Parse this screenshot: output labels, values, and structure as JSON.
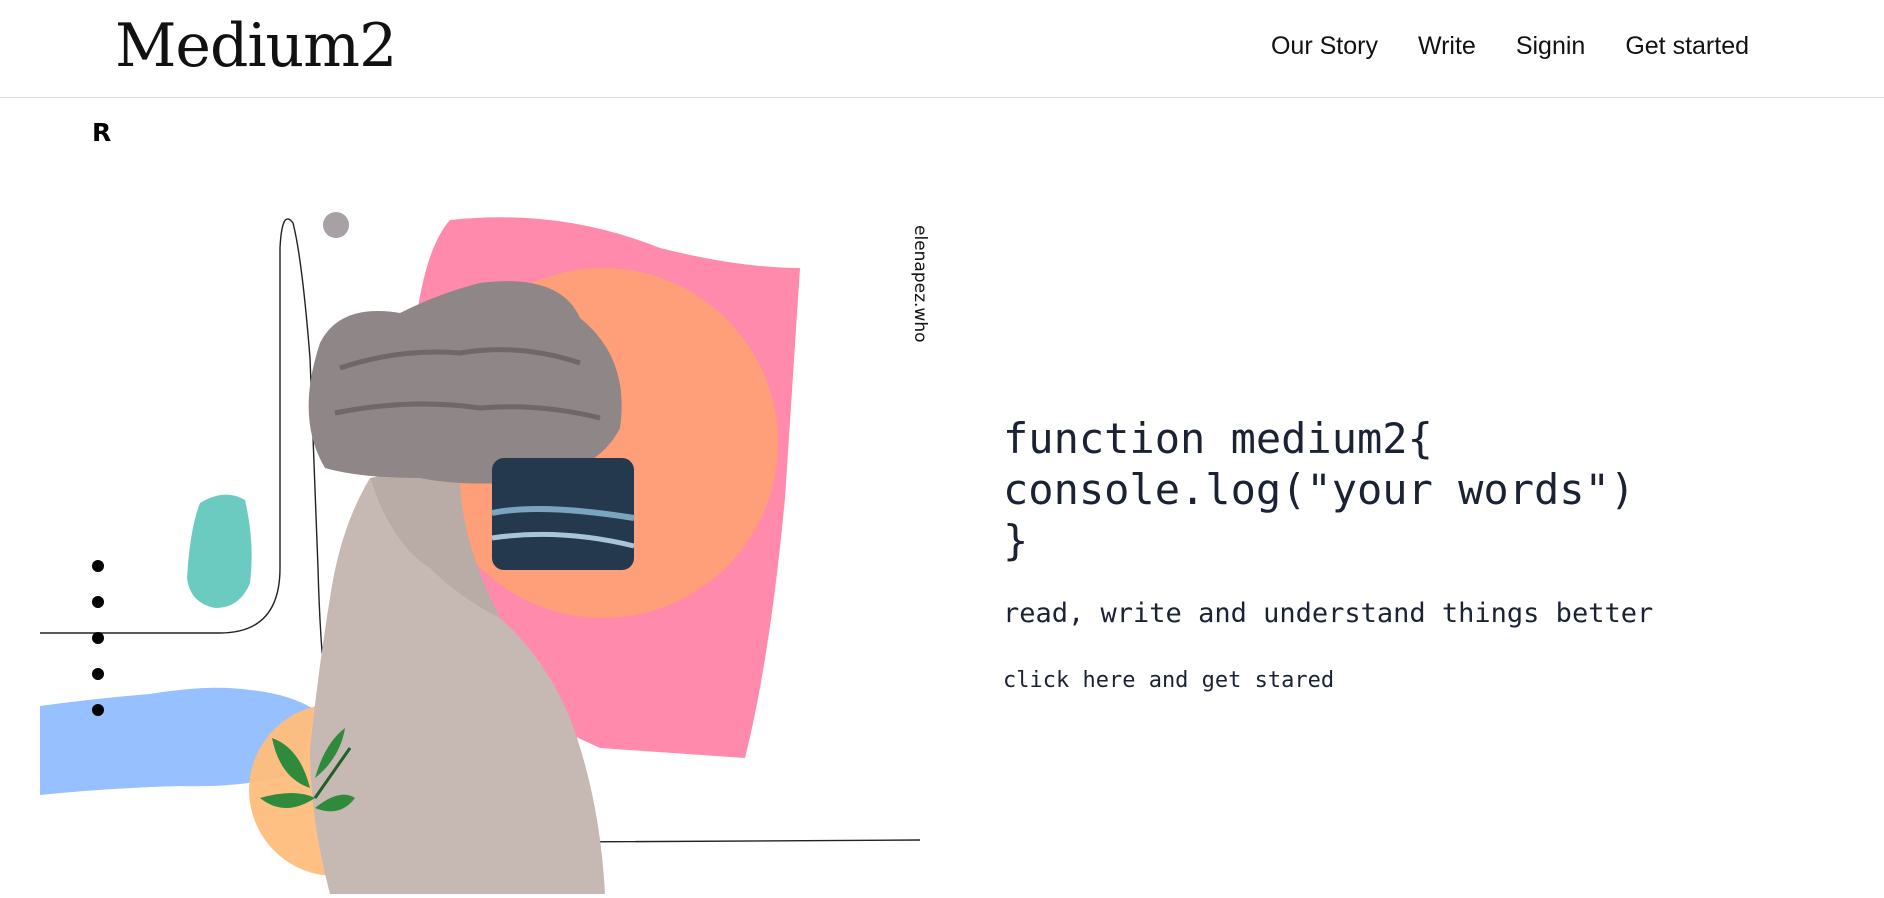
{
  "header": {
    "logo": "Medium2",
    "nav": [
      "Our Story",
      "Write",
      "Signin",
      "Get started"
    ]
  },
  "artwork": {
    "badge": "R",
    "credit": "elenapez.who",
    "colors": {
      "pink": "#ff8aac",
      "peach": "#ff9f7a",
      "blue": "#96c0ff",
      "teal": "#6ccbc0",
      "orange": "#ffbe7c",
      "gray": "#a7a0a4",
      "leaf": "#2f8a3b"
    }
  },
  "hero": {
    "code_lines": [
      "function medium2{",
      "console.log(\"your words\")",
      "}"
    ],
    "tagline": "read, write and understand things better",
    "cta": "click here and get stared"
  }
}
